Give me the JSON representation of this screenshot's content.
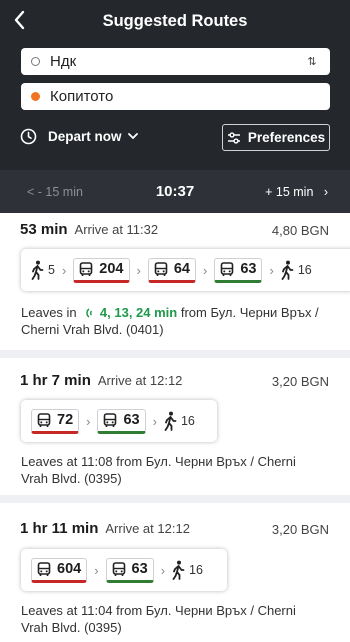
{
  "header": {
    "title": "Suggested Routes"
  },
  "origin": {
    "value": "Ндк"
  },
  "destination": {
    "value": "Копитото"
  },
  "depart": {
    "label": "Depart now"
  },
  "preferences": {
    "label": "Preferences"
  },
  "timebar": {
    "prev": "< - 15 min",
    "current": "10:37",
    "next": "+ 15 min"
  },
  "colors": {
    "header_bg": "#24272c",
    "accent_orange": "#f07421",
    "live_green": "#1e9a4a",
    "line_red": "#c62828",
    "line_green": "#2e7d32"
  },
  "routes": [
    {
      "duration": "53 min",
      "arrive": "Arrive at 11:32",
      "price": "4,80 BGN",
      "walk_start": "5",
      "buses": [
        "204",
        "64",
        "63"
      ],
      "walk_end": "16",
      "leaves_prefix": "Leaves in",
      "leaves_live": "4, 13, 24 min",
      "leaves_suffix": "from Бул. Черни Връх / Cherni Vrah Blvd. (0401)"
    },
    {
      "duration": "1 hr 7 min",
      "arrive": "Arrive at 12:12",
      "price": "3,20 BGN",
      "buses": [
        "72",
        "63"
      ],
      "walk_end": "16",
      "leaves": "Leaves at 11:08 from Бул. Черни Връх / Cherni Vrah Blvd. (0395)"
    },
    {
      "duration": "1 hr 11 min",
      "arrive": "Arrive at 12:12",
      "price": "3,20 BGN",
      "buses": [
        "604",
        "63"
      ],
      "walk_end": "16",
      "leaves": "Leaves at 11:04 from Бул. Черни Връх / Cherni Vrah Blvd. (0395)"
    }
  ]
}
